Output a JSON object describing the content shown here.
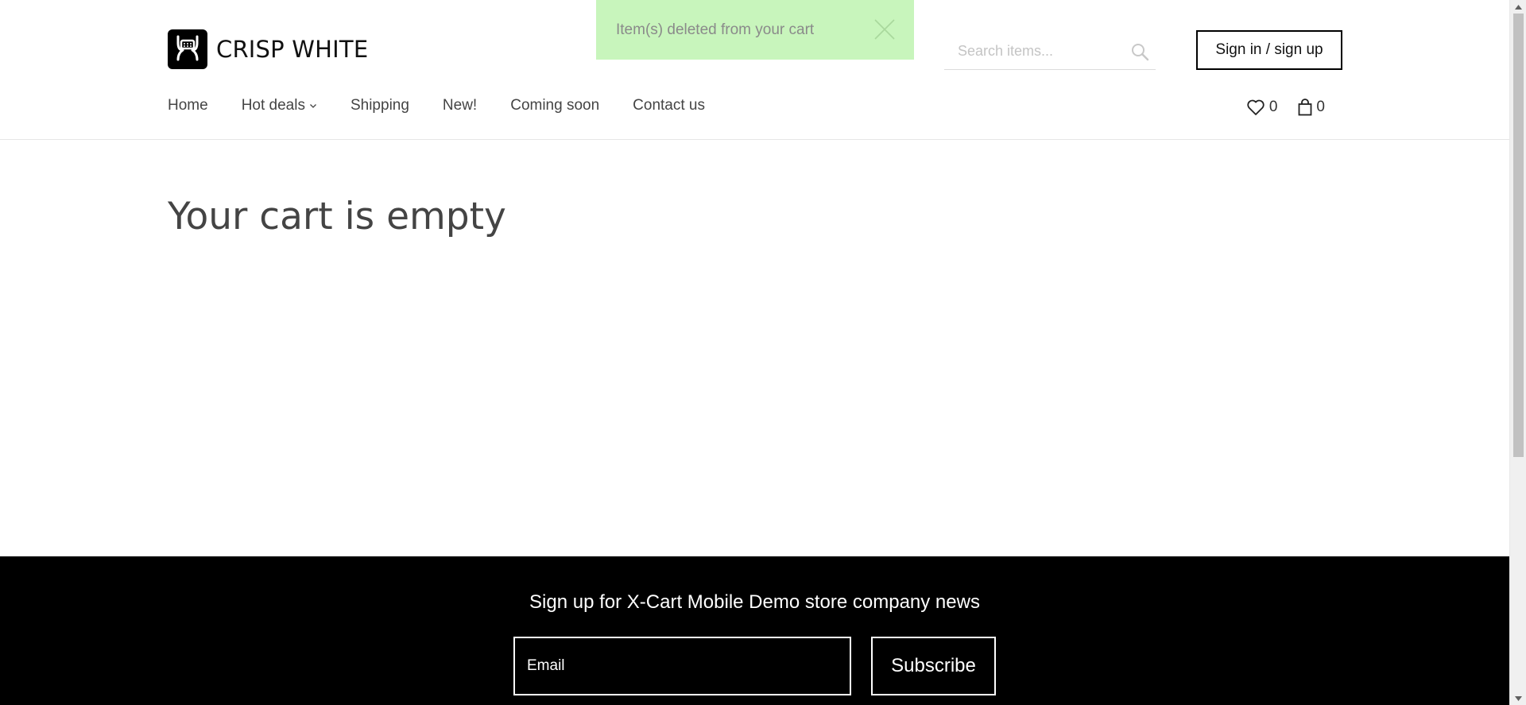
{
  "brand": {
    "name": "CRISP WHITE"
  },
  "notification": {
    "message": "Item(s) deleted from your cart"
  },
  "search": {
    "placeholder": "Search items..."
  },
  "header": {
    "signin_label": "Sign in / sign up",
    "wishlist_count": "0",
    "cart_count": "0"
  },
  "nav": {
    "items": [
      {
        "label": "Home"
      },
      {
        "label": "Hot deals",
        "has_dropdown": true
      },
      {
        "label": "Shipping"
      },
      {
        "label": "New!"
      },
      {
        "label": "Coming soon"
      },
      {
        "label": "Contact us"
      }
    ]
  },
  "main": {
    "title": "Your cart is empty"
  },
  "footer": {
    "heading": "Sign up for X-Cart Mobile Demo store company news",
    "email_placeholder": "Email",
    "subscribe_label": "Subscribe"
  },
  "icons": {
    "logo": "xcart-logo-icon",
    "close": "close-icon",
    "search": "search-icon",
    "wishlist": "heart-icon",
    "cart": "shopping-bag-icon",
    "dropdown": "chevron-down-icon"
  },
  "colors": {
    "notification_bg": "#c8f5bc",
    "footer_bg": "#000000",
    "accent": "#000000"
  }
}
